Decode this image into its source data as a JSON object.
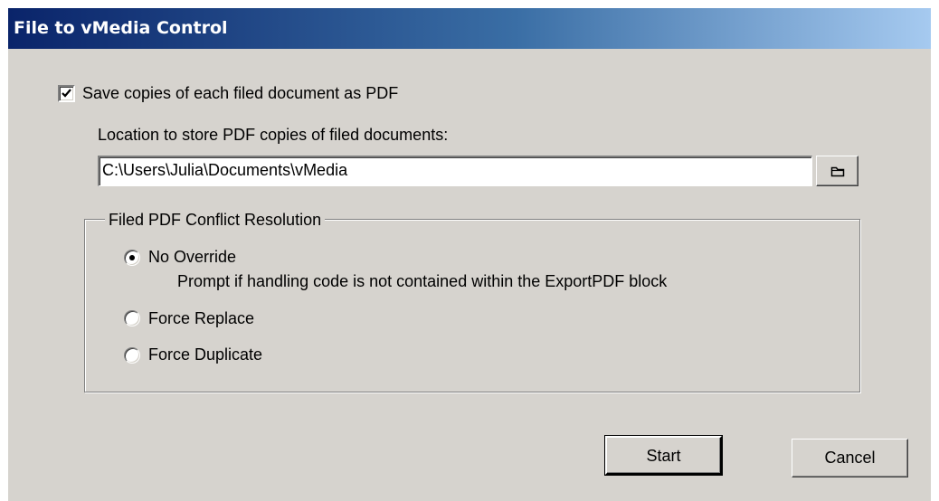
{
  "window": {
    "title": "File to vMedia Control"
  },
  "save_pdf": {
    "checkbox_label": "Save copies of each filed document as PDF",
    "checked": true
  },
  "location": {
    "label": "Location to store PDF copies of filed documents:",
    "path_value": "C:\\Users\\Julia\\Documents\\vMedia",
    "browse_icon": "folder-icon"
  },
  "conflict_group": {
    "legend": "Filed PDF Conflict Resolution",
    "options": [
      {
        "label": "No Override",
        "description": "Prompt if handling code is not contained within the ExportPDF block",
        "selected": true
      },
      {
        "label": "Force Replace",
        "selected": false
      },
      {
        "label": "Force Duplicate",
        "selected": false
      }
    ]
  },
  "actions": {
    "start_label": "Start",
    "cancel_label": "Cancel"
  },
  "colors": {
    "title_bar_start": "#0a246a",
    "title_bar_end": "#a6caf0",
    "dialog_background": "#d6d3ce"
  }
}
